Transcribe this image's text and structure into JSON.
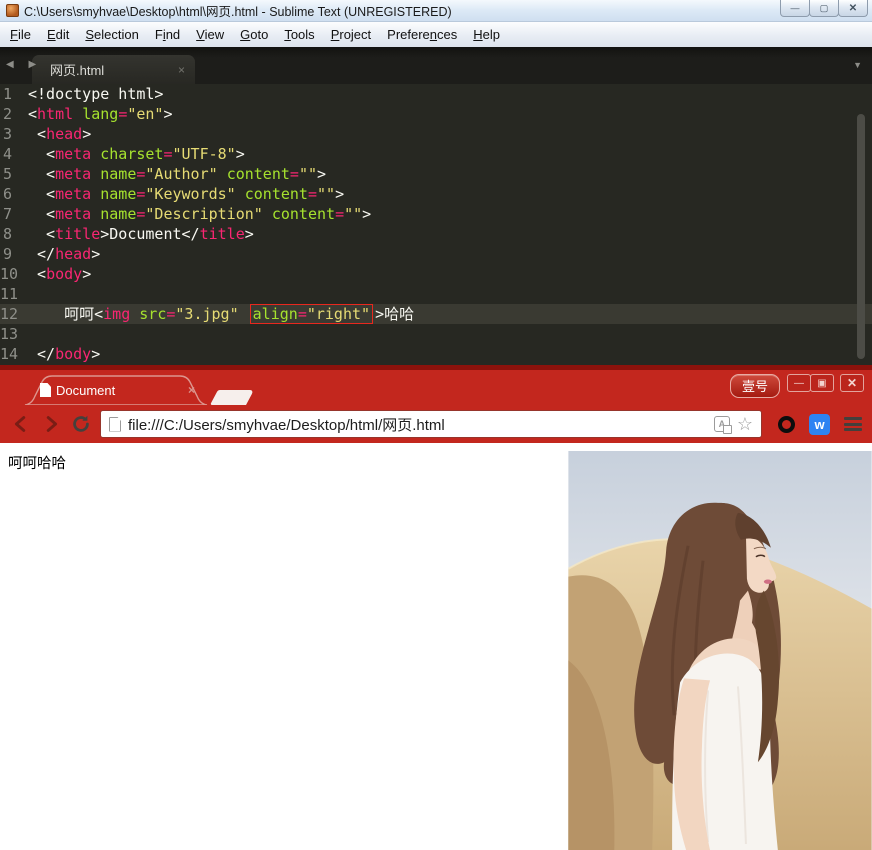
{
  "editor": {
    "title": "C:\\Users\\smyhvae\\Desktop\\html\\网页.html - Sublime Text (UNREGISTERED)",
    "window_buttons": {
      "minimize": "—",
      "maximize": "▢",
      "close": "✕"
    },
    "menu": [
      {
        "label": "File",
        "u": 0
      },
      {
        "label": "Edit",
        "u": 0
      },
      {
        "label": "Selection",
        "u": 0
      },
      {
        "label": "Find",
        "u": 1
      },
      {
        "label": "View",
        "u": 0
      },
      {
        "label": "Goto",
        "u": 0
      },
      {
        "label": "Tools",
        "u": 0
      },
      {
        "label": "Project",
        "u": 0
      },
      {
        "label": "Preferences",
        "u": 7
      },
      {
        "label": "Help",
        "u": 0
      }
    ],
    "tab": {
      "title": "网页.html",
      "close": "×"
    },
    "tab_arrows": "◀ ▶",
    "tab_dropdown": "▼",
    "current_line": 12,
    "lines": [
      [
        [
          "<!doctype html>",
          "p"
        ]
      ],
      [
        [
          "<",
          "p"
        ],
        [
          "html",
          "t"
        ],
        [
          " ",
          "p"
        ],
        [
          "lang",
          "a"
        ],
        [
          "=",
          "t"
        ],
        [
          "\"en\"",
          "s"
        ],
        [
          ">",
          "p"
        ]
      ],
      [
        [
          " <",
          "p"
        ],
        [
          "head",
          "t"
        ],
        [
          ">",
          "p"
        ]
      ],
      [
        [
          "  <",
          "p"
        ],
        [
          "meta",
          "t"
        ],
        [
          " ",
          "p"
        ],
        [
          "charset",
          "a"
        ],
        [
          "=",
          "t"
        ],
        [
          "\"UTF-8\"",
          "s"
        ],
        [
          ">",
          "p"
        ]
      ],
      [
        [
          "  <",
          "p"
        ],
        [
          "meta",
          "t"
        ],
        [
          " ",
          "p"
        ],
        [
          "name",
          "a"
        ],
        [
          "=",
          "t"
        ],
        [
          "\"Author\"",
          "s"
        ],
        [
          " ",
          "p"
        ],
        [
          "content",
          "a"
        ],
        [
          "=",
          "t"
        ],
        [
          "\"\"",
          "s"
        ],
        [
          ">",
          "p"
        ]
      ],
      [
        [
          "  <",
          "p"
        ],
        [
          "meta",
          "t"
        ],
        [
          " ",
          "p"
        ],
        [
          "name",
          "a"
        ],
        [
          "=",
          "t"
        ],
        [
          "\"Keywords\"",
          "s"
        ],
        [
          " ",
          "p"
        ],
        [
          "content",
          "a"
        ],
        [
          "=",
          "t"
        ],
        [
          "\"\"",
          "s"
        ],
        [
          ">",
          "p"
        ]
      ],
      [
        [
          "  <",
          "p"
        ],
        [
          "meta",
          "t"
        ],
        [
          " ",
          "p"
        ],
        [
          "name",
          "a"
        ],
        [
          "=",
          "t"
        ],
        [
          "\"Description\"",
          "s"
        ],
        [
          " ",
          "p"
        ],
        [
          "content",
          "a"
        ],
        [
          "=",
          "t"
        ],
        [
          "\"\"",
          "s"
        ],
        [
          ">",
          "p"
        ]
      ],
      [
        [
          "  <",
          "p"
        ],
        [
          "title",
          "t"
        ],
        [
          ">",
          "p"
        ],
        [
          "Document",
          "p"
        ],
        [
          "</",
          "p"
        ],
        [
          "title",
          "t"
        ],
        [
          ">",
          "p"
        ]
      ],
      [
        [
          " </",
          "p"
        ],
        [
          "head",
          "t"
        ],
        [
          ">",
          "p"
        ]
      ],
      [
        [
          " <",
          "p"
        ],
        [
          "body",
          "t"
        ],
        [
          ">",
          "p"
        ]
      ],
      [],
      [
        [
          "    呵呵",
          "p"
        ],
        [
          "<",
          "p"
        ],
        [
          "img",
          "t"
        ],
        [
          " ",
          "p"
        ],
        [
          "src",
          "a"
        ],
        [
          "=",
          "t"
        ],
        [
          "\"3.jpg\"",
          "s"
        ],
        [
          " ",
          "p"
        ],
        [
          "align",
          "a",
          1
        ],
        [
          "=",
          "t",
          1
        ],
        [
          "\"right\"",
          "s",
          1
        ],
        [
          ">",
          "p"
        ],
        [
          "哈哈",
          "p"
        ]
      ],
      [],
      [
        [
          " </",
          "p"
        ],
        [
          "body",
          "t"
        ],
        [
          ">",
          "p"
        ]
      ]
    ]
  },
  "browser": {
    "tab_title": "Document",
    "tab_close": "×",
    "account_button": "壹号",
    "window_buttons": {
      "minimize": "—",
      "maximize": "▣",
      "close": "✕"
    },
    "url": "file:///C:/Users/smyhvae/Desktop/html/网页.html",
    "translate_glyph": "A",
    "star_glyph": "☆",
    "w_badge": "w",
    "page_text": "呵呵哈哈"
  },
  "colors": {
    "editor_bg": "#272822",
    "editor_current_line": "#3a3a32",
    "syntax_tag": "#f92672",
    "syntax_attr": "#a6e22e",
    "syntax_string": "#e6db74",
    "syntax_plain": "#f8f8f2",
    "line_number": "#8f908a",
    "annotation_box": "#e8281e",
    "browser_red": "#c3271e",
    "browser_red_dark": "#8c120c",
    "photo_sky": "#c9d2de",
    "photo_sand_light": "#e9d4aa",
    "photo_sand_dark": "#c9aa78",
    "photo_hair": "#6e4b37",
    "photo_skin": "#f3d9c5",
    "photo_dress": "#f7f4f0"
  }
}
